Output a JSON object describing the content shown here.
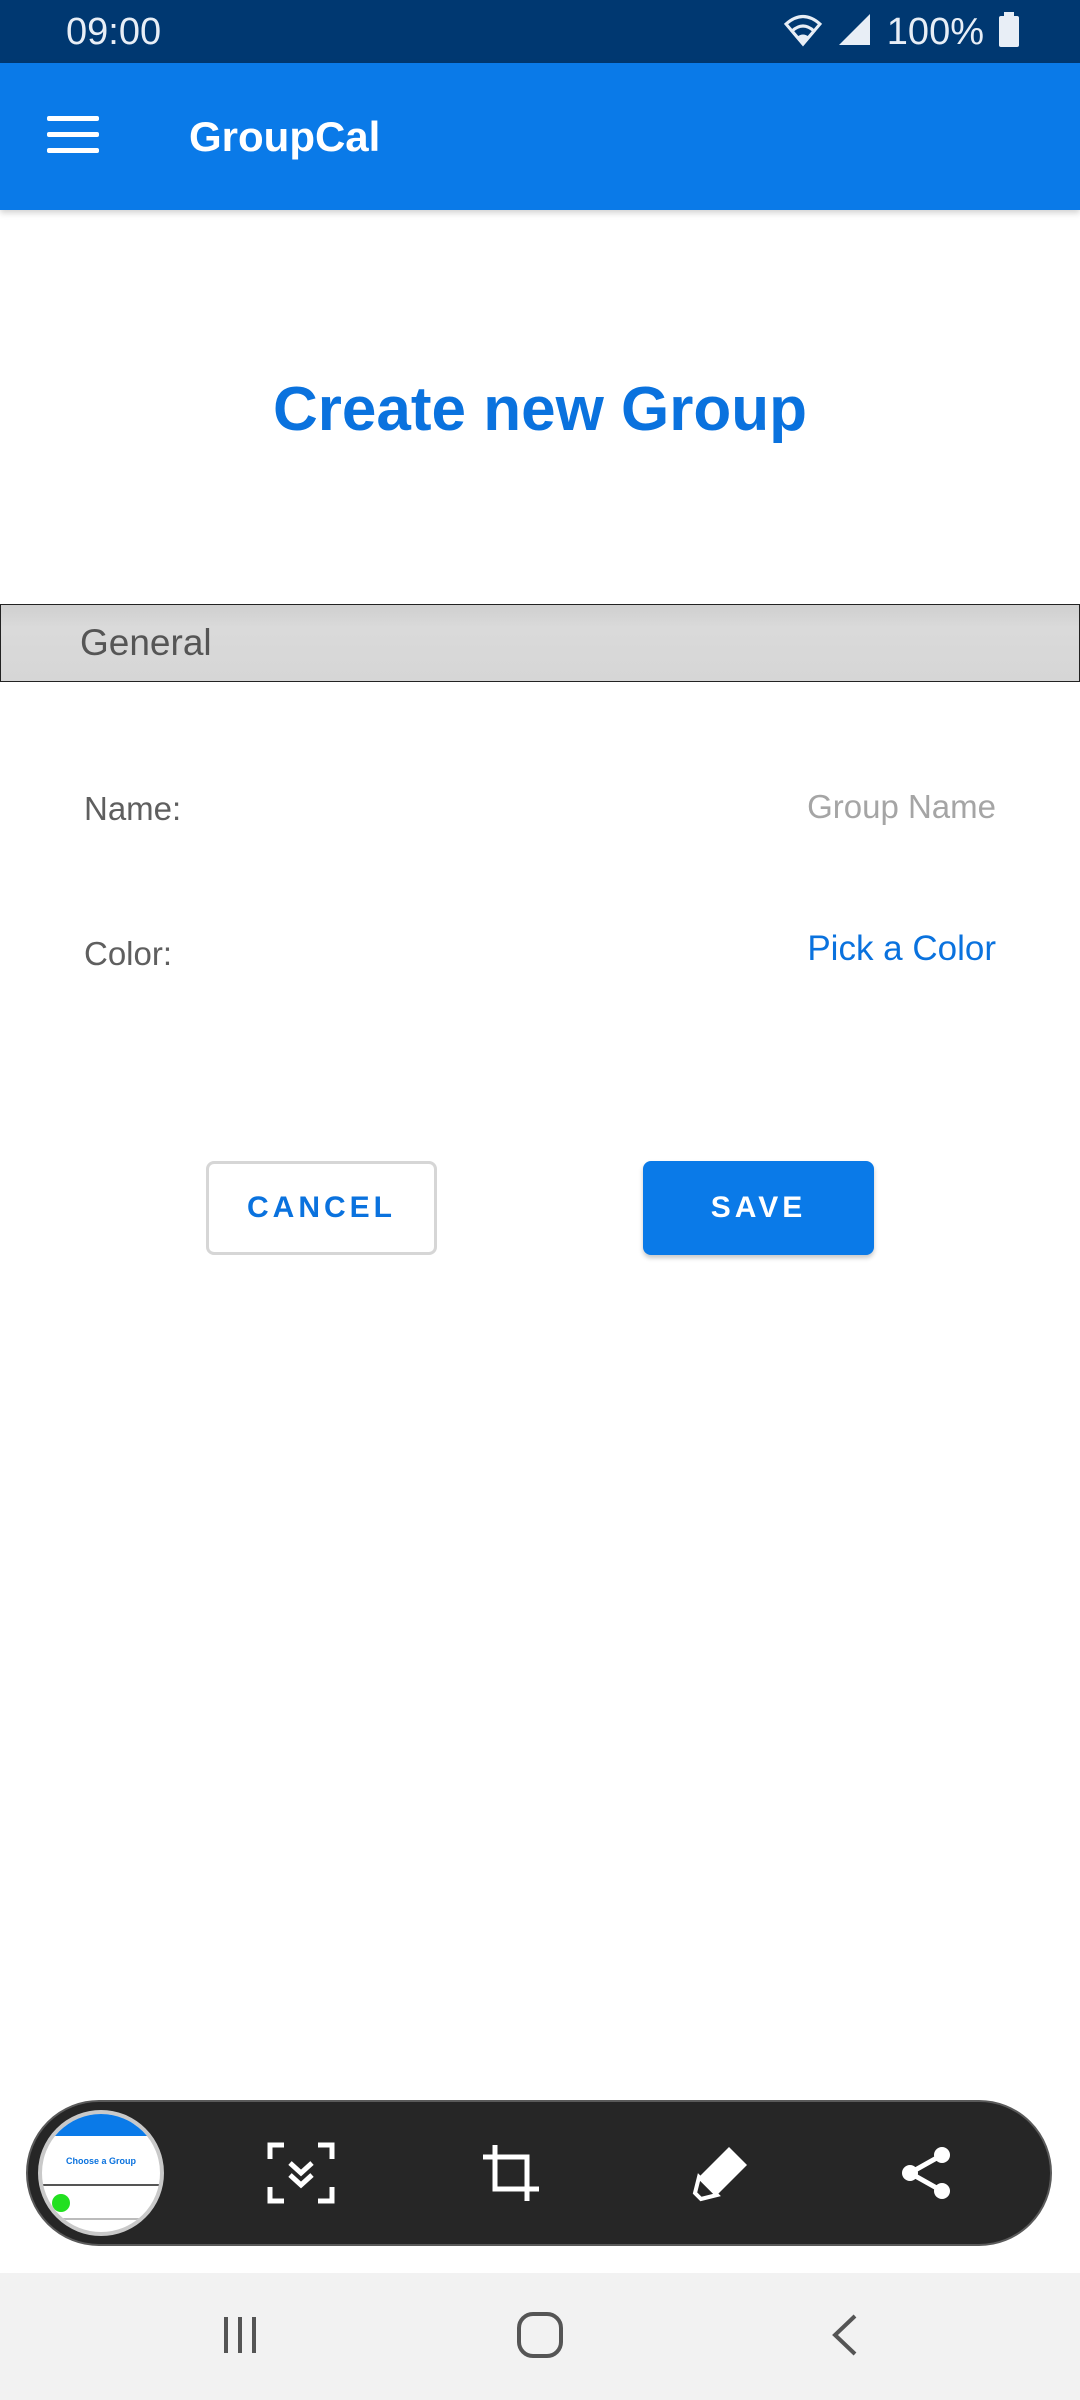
{
  "status_bar": {
    "time": "09:00",
    "battery": "100%",
    "icons": [
      "wifi-icon",
      "signal-icon",
      "battery-icon"
    ]
  },
  "app_bar": {
    "title": "GroupCal",
    "menu_icon": "hamburger-menu-icon"
  },
  "page": {
    "title": "Create new Group"
  },
  "section": {
    "label": "General"
  },
  "form": {
    "name_label": "Name:",
    "name_value": "",
    "name_placeholder": "Group Name",
    "color_label": "Color:",
    "color_action": "Pick a Color"
  },
  "actions": {
    "cancel_label": "CANCEL",
    "save_label": "SAVE"
  },
  "screenshot_toolbar": {
    "thumbnail": {
      "title": "Choose a Group"
    },
    "tools": [
      "scroll-capture-icon",
      "crop-icon",
      "draw-icon",
      "share-icon"
    ]
  },
  "nav_bar": {
    "buttons": [
      "recent-apps-icon",
      "home-icon",
      "back-icon"
    ]
  },
  "colors": {
    "status_bar": "#003871",
    "primary": "#0a7ae8",
    "title_blue": "#0a72de",
    "section_bg": "#d6d6d6",
    "toolbar_bg": "#262626"
  }
}
